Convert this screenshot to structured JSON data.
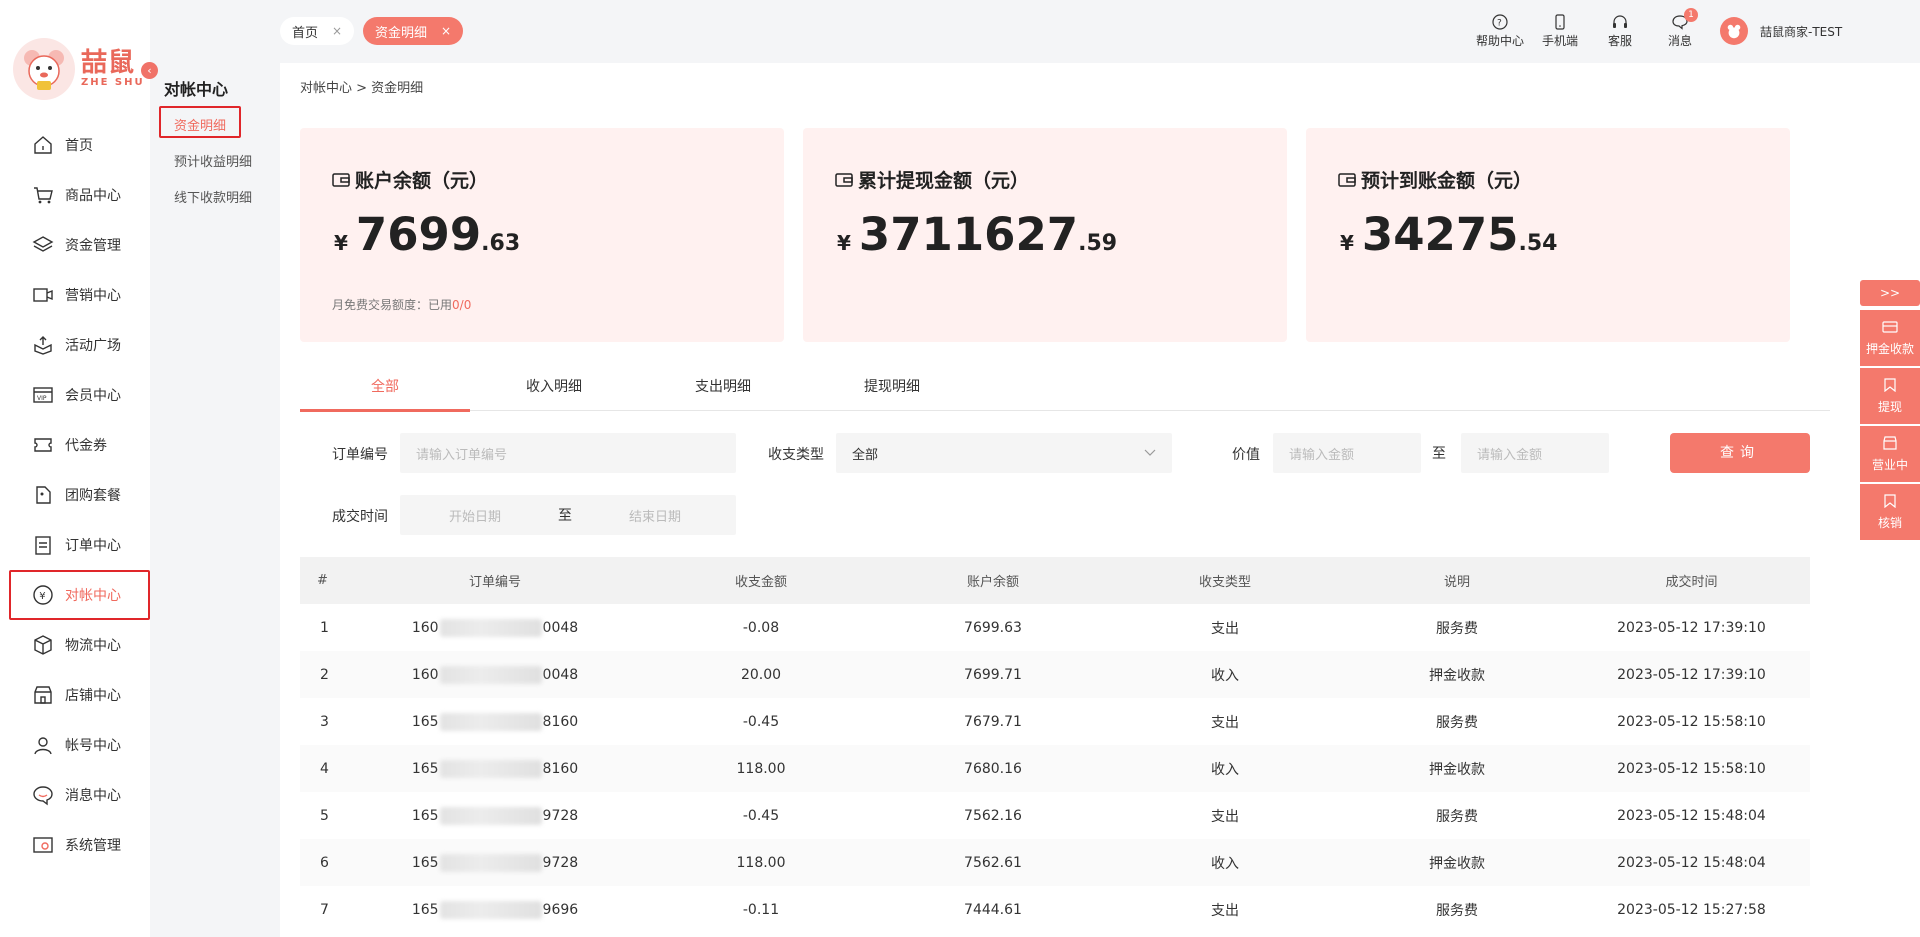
{
  "brand": {
    "name_cn": "喆鼠",
    "name_en": "ZHE SHU"
  },
  "sidebar": {
    "collapse_icon": "chevron-left-icon",
    "items": [
      {
        "label": "首页",
        "icon": "home-icon"
      },
      {
        "label": "商品中心",
        "icon": "cart-icon"
      },
      {
        "label": "资金管理",
        "icon": "layers-icon"
      },
      {
        "label": "营销中心",
        "icon": "marketing-icon"
      },
      {
        "label": "活动广场",
        "icon": "activity-icon"
      },
      {
        "label": "会员中心",
        "icon": "vip-icon"
      },
      {
        "label": "代金券",
        "icon": "coupon-icon"
      },
      {
        "label": "团购套餐",
        "icon": "package-icon"
      },
      {
        "label": "订单中心",
        "icon": "order-icon"
      },
      {
        "label": "对帐中心",
        "icon": "yen-icon",
        "active": true
      },
      {
        "label": "物流中心",
        "icon": "box-icon"
      },
      {
        "label": "店铺中心",
        "icon": "store-icon"
      },
      {
        "label": "帐号中心",
        "icon": "user-icon"
      },
      {
        "label": "消息中心",
        "icon": "chat-icon"
      },
      {
        "label": "系统管理",
        "icon": "settings-icon"
      }
    ]
  },
  "submenu": {
    "title": "对帐中心",
    "items": [
      {
        "label": "资金明细",
        "active": true
      },
      {
        "label": "预计收益明细"
      },
      {
        "label": "线下收款明细"
      }
    ]
  },
  "topbar": {
    "tabs": [
      {
        "label": "首页",
        "close": "×"
      },
      {
        "label": "资金明细",
        "close": "×",
        "active": true
      }
    ],
    "tools": [
      {
        "label": "帮助中心",
        "icon": "help-icon"
      },
      {
        "label": "手机端",
        "icon": "mobile-icon"
      },
      {
        "label": "客服",
        "icon": "headset-icon"
      },
      {
        "label": "消息",
        "icon": "message-icon",
        "badge": "1"
      }
    ],
    "user": {
      "name": "喆鼠商家-TEST"
    }
  },
  "breadcrumb": "对帐中心 > 资金明细",
  "cards": [
    {
      "title": "账户余额（元）",
      "currency": "¥",
      "int": "7699",
      "dec": ".63",
      "quota_label": "月免费交易额度：已用",
      "quota_value": "0/0"
    },
    {
      "title": "累计提现金额（元）",
      "currency": "¥",
      "int": "3711627",
      "dec": ".59"
    },
    {
      "title": "预计到账金额（元）",
      "currency": "¥",
      "int": "34275",
      "dec": ".54"
    }
  ],
  "filter_tabs": [
    "全部",
    "收入明细",
    "支出明细",
    "提现明细"
  ],
  "filters": {
    "order_no": {
      "label": "订单编号",
      "placeholder": "请输入订单编号"
    },
    "type": {
      "label": "收支类型",
      "value": "全部"
    },
    "value": {
      "label": "价值",
      "min_placeholder": "请输入金额",
      "sep": "至",
      "max_placeholder": "请输入金额"
    },
    "time": {
      "label": "成交时间",
      "start_placeholder": "开始日期",
      "sep": "至",
      "end_placeholder": "结束日期"
    },
    "query_button": "查询"
  },
  "table": {
    "headers": [
      "#",
      "订单编号",
      "收支金额",
      "账户余额",
      "收支类型",
      "说明",
      "成交时间"
    ],
    "rows": [
      {
        "idx": "1",
        "order_prefix": "160",
        "order_suffix": "0048",
        "amount": "-0.08",
        "balance": "7699.63",
        "type": "支出",
        "desc": "服务费",
        "time": "2023-05-12 17:39:10"
      },
      {
        "idx": "2",
        "order_prefix": "160",
        "order_suffix": "0048",
        "amount": "20.00",
        "balance": "7699.71",
        "type": "收入",
        "desc": "押金收款",
        "time": "2023-05-12 17:39:10"
      },
      {
        "idx": "3",
        "order_prefix": "165",
        "order_suffix": "8160",
        "amount": "-0.45",
        "balance": "7679.71",
        "type": "支出",
        "desc": "服务费",
        "time": "2023-05-12 15:58:10"
      },
      {
        "idx": "4",
        "order_prefix": "165",
        "order_suffix": "8160",
        "amount": "118.00",
        "balance": "7680.16",
        "type": "收入",
        "desc": "押金收款",
        "time": "2023-05-12 15:58:10"
      },
      {
        "idx": "5",
        "order_prefix": "165",
        "order_suffix": "9728",
        "amount": "-0.45",
        "balance": "7562.16",
        "type": "支出",
        "desc": "服务费",
        "time": "2023-05-12 15:48:04"
      },
      {
        "idx": "6",
        "order_prefix": "165",
        "order_suffix": "9728",
        "amount": "118.00",
        "balance": "7562.61",
        "type": "收入",
        "desc": "押金收款",
        "time": "2023-05-12 15:48:04"
      },
      {
        "idx": "7",
        "order_prefix": "165",
        "order_suffix": "9696",
        "amount": "-0.11",
        "balance": "7444.61",
        "type": "支出",
        "desc": "服务费",
        "time": "2023-05-12 15:27:58"
      }
    ]
  },
  "side_panel": {
    "toggle": ">>",
    "items": [
      {
        "label": "押金收款",
        "icon": "card-icon"
      },
      {
        "label": "提现",
        "icon": "bookmark-icon"
      },
      {
        "label": "营业中",
        "icon": "shop-icon"
      },
      {
        "label": "核销",
        "icon": "bookmark-icon"
      }
    ]
  },
  "colors": {
    "accent": "#f4796c",
    "active_text": "#f06a5e",
    "card_bg": "#fff1f0",
    "highlight_box": "#e0262a"
  }
}
